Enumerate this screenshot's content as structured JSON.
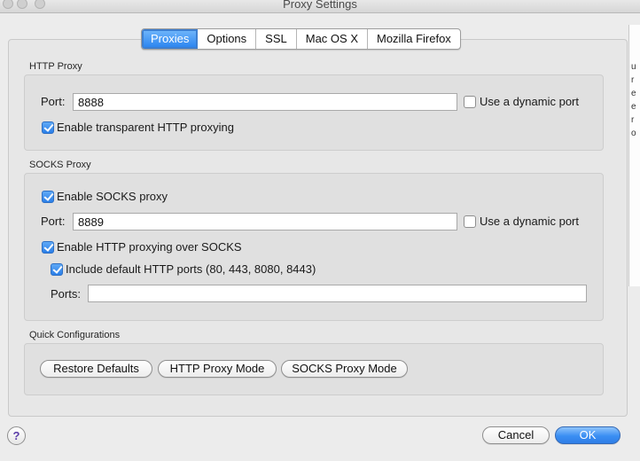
{
  "window": {
    "title": "Proxy Settings"
  },
  "background_window": {
    "glyphs": [
      "u",
      "r",
      "e",
      "e",
      "r",
      "o"
    ]
  },
  "tabs": [
    {
      "label": "Proxies",
      "active": true
    },
    {
      "label": "Options",
      "active": false
    },
    {
      "label": "SSL",
      "active": false
    },
    {
      "label": "Mac OS X",
      "active": false
    },
    {
      "label": "Mozilla Firefox",
      "active": false
    }
  ],
  "http_proxy": {
    "section_label": "HTTP Proxy",
    "port_label": "Port:",
    "port_value": "8888",
    "dynamic_port_label": "Use a dynamic port",
    "dynamic_port_checked": false,
    "transparent_label": "Enable transparent HTTP proxying",
    "transparent_checked": true
  },
  "socks_proxy": {
    "section_label": "SOCKS Proxy",
    "enable_label": "Enable SOCKS proxy",
    "enable_checked": true,
    "port_label": "Port:",
    "port_value": "8889",
    "dynamic_port_label": "Use a dynamic port",
    "dynamic_port_checked": false,
    "http_over_socks_label": "Enable HTTP proxying over SOCKS",
    "http_over_socks_checked": true,
    "include_default_label": "Include default HTTP ports (80, 443, 8080, 8443)",
    "include_default_checked": true,
    "ports_label": "Ports:",
    "ports_value": ""
  },
  "quick_config": {
    "section_label": "Quick Configurations",
    "restore_defaults": "Restore Defaults",
    "http_proxy_mode": "HTTP Proxy Mode",
    "socks_proxy_mode": "SOCKS Proxy Mode"
  },
  "footer": {
    "help_glyph": "?",
    "cancel_label": "Cancel",
    "ok_label": "OK"
  },
  "colors": {
    "accent": "#2d86f0",
    "window_bg": "#ececec",
    "group_bg": "#e0e0e0"
  }
}
